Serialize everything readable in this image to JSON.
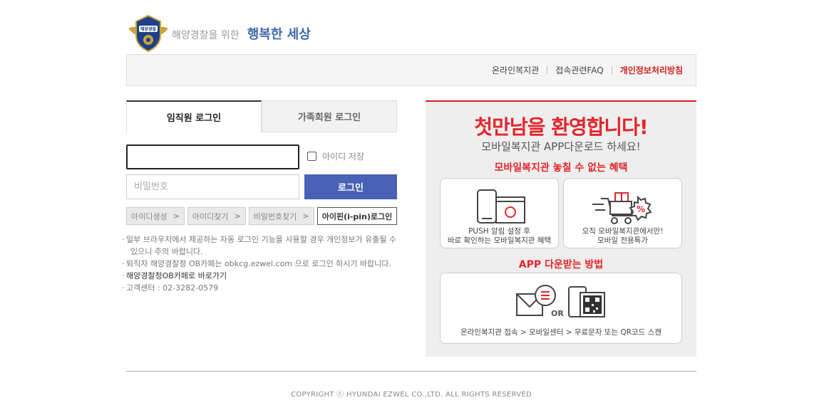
{
  "header": {
    "logo_text": "해양경찰",
    "brand_sub": "해양경찰을 위한",
    "brand_main": "행복한 세상"
  },
  "topnav": {
    "items": [
      "온라인복지관",
      "접속관련FAQ",
      "개인정보처리방침"
    ],
    "highlight_color": "#d4201f"
  },
  "login": {
    "tabs": [
      "임직원 로그인",
      "가족회원 로그인"
    ],
    "active_tab": 0,
    "id_value": "",
    "pw_placeholder": "비밀번호",
    "save_id_label": "아이디 저장",
    "login_button": "로그인",
    "sub_buttons": [
      "아이디생성",
      "아이디찾기",
      "비밀번호찾기"
    ],
    "ipin_button": "아이핀(i-pin)로그인",
    "accent_color": "#4962b5"
  },
  "notes": {
    "line1a": "일부 브라우저에서 제공하는 자동 로그인 기능을 사용할 경우 개인정보가 유출될 수",
    "line1b": "있으니 주의 바랍니다.",
    "line2": "퇴직자 해양경찰청 OB카페는 obkcg.ezwel.com 으로 로그인 하시기 바랍니다.",
    "line3": "해양경찰청OB카페로 바로가기",
    "line4": "고객센터 : 02-3282-0579"
  },
  "promo": {
    "title": "첫만남을 환영합니다!",
    "subtitle": "모바일복지관 APP다운로드 하세요!",
    "benefit_heading": "모바일복지관 놓칠 수 없는 혜택",
    "card1_line1": "PUSH 알림 설정 후",
    "card1_line2": "바로 확인하는 모바일복지관 혜택",
    "card2_line1": "오직 모바일복지관에서만!",
    "card2_line2": "모바일 전용특가",
    "download_heading": "APP 다운받는 방법",
    "or_label": "OR",
    "steps": "온라인복지관 접속 > 모바일센터 > 무료문자 또는 QR코드 스캔",
    "accent_color": "#e2262c"
  },
  "footer": {
    "copyright": "COPYRIGHT ⓒ HYUNDAI EZWEL CO.,LTD. ALL RIGHTS RESERVED"
  }
}
